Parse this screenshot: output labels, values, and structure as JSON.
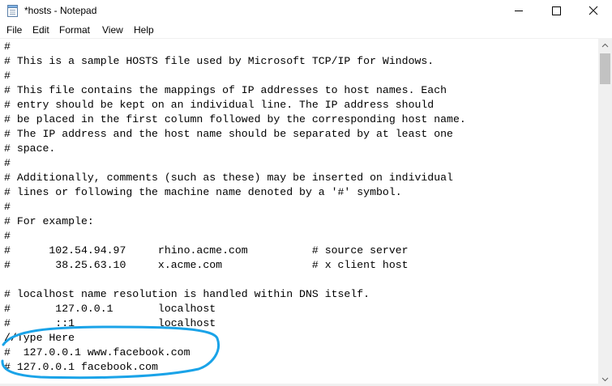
{
  "window": {
    "title": "*hosts - Notepad",
    "icon": "notepad-icon"
  },
  "controls": {
    "minimize": "minimize-icon",
    "maximize": "maximize-icon",
    "close": "close-icon"
  },
  "menu": [
    "File",
    "Edit",
    "Format",
    "View",
    "Help"
  ],
  "editor": {
    "lines": [
      "#",
      "# This is a sample HOSTS file used by Microsoft TCP/IP for Windows.",
      "#",
      "# This file contains the mappings of IP addresses to host names. Each",
      "# entry should be kept on an individual line. The IP address should",
      "# be placed in the first column followed by the corresponding host name.",
      "# The IP address and the host name should be separated by at least one",
      "# space.",
      "#",
      "# Additionally, comments (such as these) may be inserted on individual",
      "# lines or following the machine name denoted by a '#' symbol.",
      "#",
      "# For example:",
      "#",
      "#      102.54.94.97     rhino.acme.com          # source server",
      "#       38.25.63.10     x.acme.com              # x client host",
      "",
      "# localhost name resolution is handled within DNS itself.",
      "#       127.0.0.1       localhost",
      "#       ::1             localhost",
      "//Type Here",
      "#  127.0.0.1 www.facebook.com",
      "# 127.0.0.1 facebook.com"
    ]
  },
  "colors": {
    "annotation": "#1aa3e8",
    "scrollbar_track": "#f0f0f0",
    "scrollbar_thumb": "#c2c2c2"
  }
}
